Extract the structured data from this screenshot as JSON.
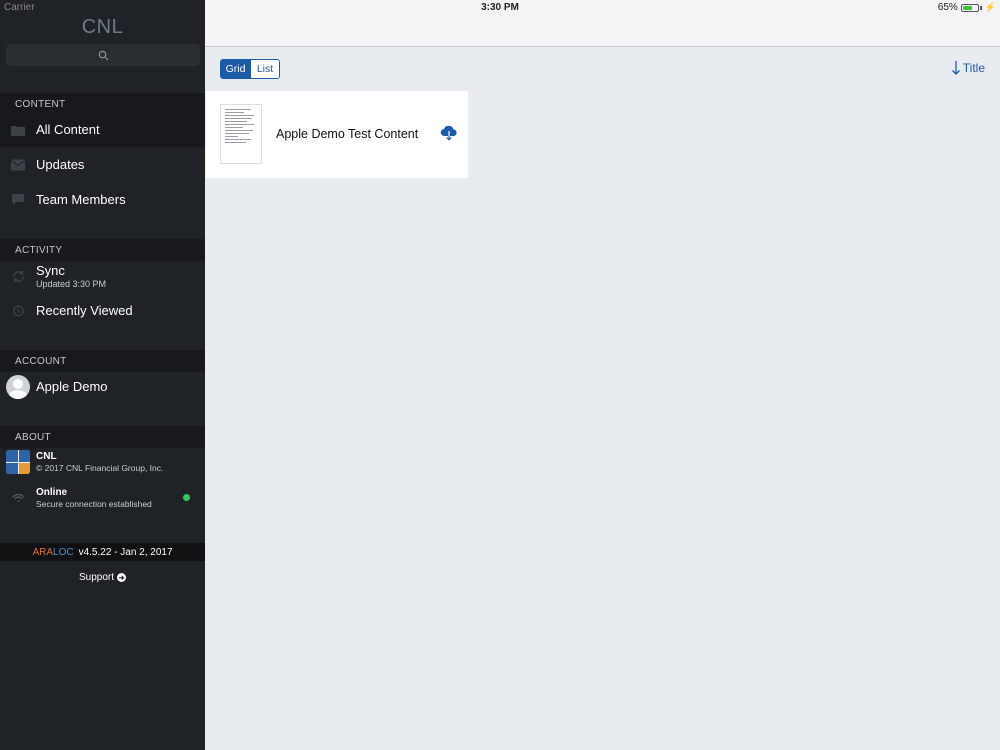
{
  "status_bar": {
    "carrier": "Carrier",
    "time": "3:30 PM",
    "battery": "65%",
    "battery_level": 0.65
  },
  "sidebar": {
    "brand": "CNL",
    "sections": {
      "content": "CONTENT",
      "activity": "ACTIVITY",
      "account": "ACCOUNT",
      "about": "ABOUT"
    },
    "content_items": [
      {
        "label": "All Content",
        "icon": "folder-icon"
      },
      {
        "label": "Updates",
        "icon": "envelope-icon"
      },
      {
        "label": "Team Members",
        "icon": "chat-bubble-icon"
      }
    ],
    "sync": {
      "label": "Sync",
      "subtitle": "Updated 3:30 PM",
      "icon": "sync-icon"
    },
    "recently_viewed": {
      "label": "Recently Viewed",
      "icon": "history-icon"
    },
    "account_name": "Apple Demo",
    "about_app": {
      "name": "CNL",
      "copyright": "© 2017 CNL Financial Group, Inc."
    },
    "connection": {
      "status": "Online",
      "detail": "Secure connection established",
      "dot_color": "#34c759"
    },
    "version": {
      "brand_ara": "ARA",
      "brand_loc": "LOC",
      "text": "v4.5.22 - Jan 2, 2017"
    },
    "support_label": "Support"
  },
  "main": {
    "view_toggle": {
      "grid": "Grid",
      "list": "List",
      "selected": "Grid"
    },
    "sort_label": "Title",
    "items": [
      {
        "title": "Apple Demo Test Content"
      }
    ]
  },
  "colors": {
    "accent": "#1d5aa8",
    "sidebar_bg": "#1f2226"
  }
}
